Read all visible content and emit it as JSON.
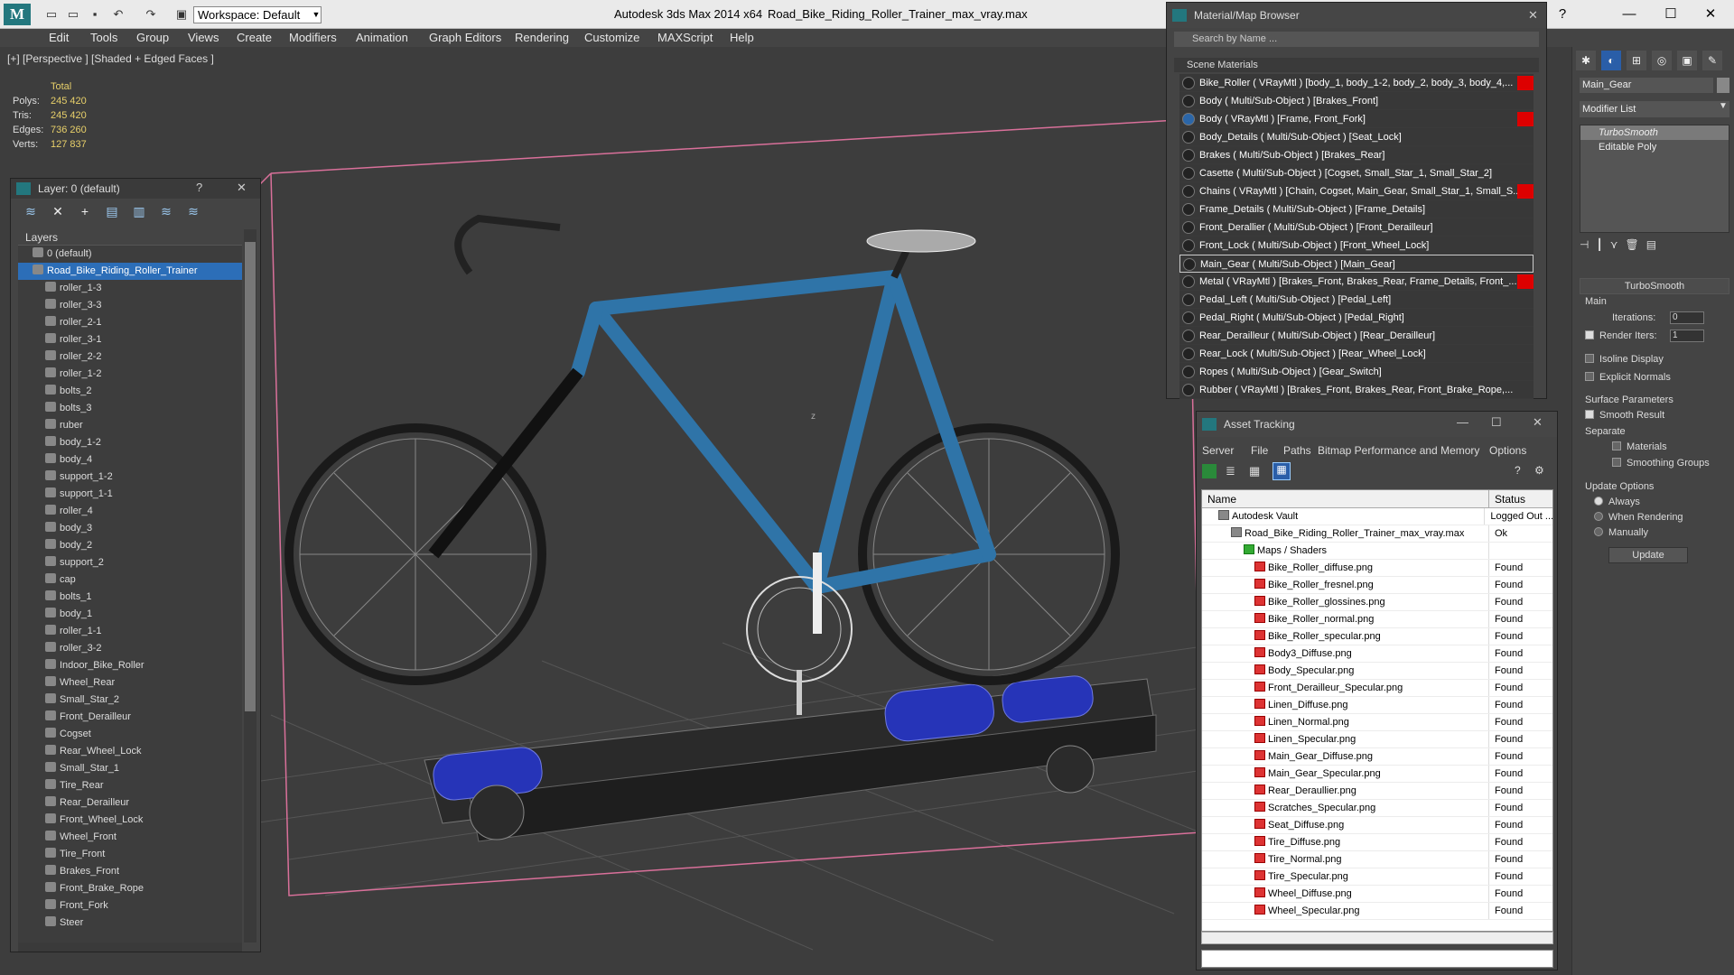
{
  "titlebar": {
    "workspace": "Workspace: Default",
    "app_title": "Autodesk 3ds Max  2014 x64",
    "file_title": "Road_Bike_Riding_Roller_Trainer_max_vray.max"
  },
  "menu": [
    "Edit",
    "Tools",
    "Group",
    "Views",
    "Create",
    "Modifiers",
    "Animation",
    "Graph Editors",
    "Rendering",
    "Customize",
    "MAXScript",
    "Help"
  ],
  "viewport": {
    "label": "[+] [Perspective ] [Shaded + Edged Faces ]",
    "stats_header": "Total",
    "stats": [
      {
        "k": "Polys:",
        "v": "245 420"
      },
      {
        "k": "Tris:",
        "v": "245 420"
      },
      {
        "k": "Edges:",
        "v": "736 260"
      },
      {
        "k": "Verts:",
        "v": "127 837"
      }
    ],
    "axis_z": "z"
  },
  "layer_panel": {
    "title": "Layer: 0 (default)",
    "help": "?",
    "close": "✕",
    "header": "Layers",
    "items": [
      {
        "label": "0 (default)",
        "level": 1
      },
      {
        "label": "Road_Bike_Riding_Roller_Trainer",
        "level": 1,
        "selected": true
      },
      {
        "label": "roller_1-3",
        "level": 2
      },
      {
        "label": "roller_3-3",
        "level": 2
      },
      {
        "label": "roller_2-1",
        "level": 2
      },
      {
        "label": "roller_3-1",
        "level": 2
      },
      {
        "label": "roller_2-2",
        "level": 2
      },
      {
        "label": "roller_1-2",
        "level": 2
      },
      {
        "label": "bolts_2",
        "level": 2
      },
      {
        "label": "bolts_3",
        "level": 2
      },
      {
        "label": "ruber",
        "level": 2
      },
      {
        "label": "body_1-2",
        "level": 2
      },
      {
        "label": "body_4",
        "level": 2
      },
      {
        "label": "support_1-2",
        "level": 2
      },
      {
        "label": "support_1-1",
        "level": 2
      },
      {
        "label": "roller_4",
        "level": 2
      },
      {
        "label": "body_3",
        "level": 2
      },
      {
        "label": "body_2",
        "level": 2
      },
      {
        "label": "support_2",
        "level": 2
      },
      {
        "label": "cap",
        "level": 2
      },
      {
        "label": "bolts_1",
        "level": 2
      },
      {
        "label": "body_1",
        "level": 2
      },
      {
        "label": "roller_1-1",
        "level": 2
      },
      {
        "label": "roller_3-2",
        "level": 2
      },
      {
        "label": "Indoor_Bike_Roller",
        "level": 2
      },
      {
        "label": "Wheel_Rear",
        "level": 2
      },
      {
        "label": "Small_Star_2",
        "level": 2
      },
      {
        "label": "Front_Derailleur",
        "level": 2
      },
      {
        "label": "Cogset",
        "level": 2
      },
      {
        "label": "Rear_Wheel_Lock",
        "level": 2
      },
      {
        "label": "Small_Star_1",
        "level": 2
      },
      {
        "label": "Tire_Rear",
        "level": 2
      },
      {
        "label": "Rear_Derailleur",
        "level": 2
      },
      {
        "label": "Front_Wheel_Lock",
        "level": 2
      },
      {
        "label": "Wheel_Front",
        "level": 2
      },
      {
        "label": "Tire_Front",
        "level": 2
      },
      {
        "label": "Brakes_Front",
        "level": 2
      },
      {
        "label": "Front_Brake_Rope",
        "level": 2
      },
      {
        "label": "Front_Fork",
        "level": 2
      },
      {
        "label": "Steer",
        "level": 2
      }
    ]
  },
  "material_browser": {
    "title": "Material/Map Browser",
    "close": "✕",
    "search_placeholder": "Search by Name ...",
    "section": "Scene Materials",
    "items": [
      {
        "label": "Bike_Roller  ( VRayMtl ) [body_1, body_1-2, body_2, body_3, body_4,...",
        "red": true
      },
      {
        "label": "Body  ( Multi/Sub-Object ) [Brakes_Front]"
      },
      {
        "label": "Body  ( VRayMtl ) [Frame, Front_Fork]",
        "red": true,
        "blue": true
      },
      {
        "label": "Body_Details  ( Multi/Sub-Object ) [Seat_Lock]"
      },
      {
        "label": "Brakes  ( Multi/Sub-Object ) [Brakes_Rear]"
      },
      {
        "label": "Casette  ( Multi/Sub-Object ) [Cogset, Small_Star_1, Small_Star_2]"
      },
      {
        "label": "Chains  ( VRayMtl ) [Chain, Cogset, Main_Gear, Small_Star_1, Small_S...",
        "red": true
      },
      {
        "label": "Frame_Details  ( Multi/Sub-Object ) [Frame_Details]"
      },
      {
        "label": "Front_Derallier  ( Multi/Sub-Object ) [Front_Derailleur]"
      },
      {
        "label": "Front_Lock  ( Multi/Sub-Object ) [Front_Wheel_Lock]"
      },
      {
        "label": "Main_Gear  ( Multi/Sub-Object ) [Main_Gear]",
        "selected": true
      },
      {
        "label": "Metal  ( VRayMtl ) [Brakes_Front, Brakes_Rear, Frame_Details, Front_...",
        "red": true
      },
      {
        "label": "Pedal_Left  ( Multi/Sub-Object ) [Pedal_Left]"
      },
      {
        "label": "Pedal_Right  ( Multi/Sub-Object ) [Pedal_Right]"
      },
      {
        "label": "Rear_Derailleur  ( Multi/Sub-Object ) [Rear_Derailleur]"
      },
      {
        "label": "Rear_Lock  ( Multi/Sub-Object ) [Rear_Wheel_Lock]"
      },
      {
        "label": "Ropes  ( Multi/Sub-Object ) [Gear_Switch]"
      },
      {
        "label": "Rubber  ( VRayMtl ) [Brakes_Front, Brakes_Rear, Front_Brake_Rope,..."
      }
    ]
  },
  "asset_tracking": {
    "title": "Asset Tracking",
    "menu": [
      "Server",
      "File",
      "Paths",
      "Bitmap Performance and Memory",
      "Options"
    ],
    "col_name": "Name",
    "col_status": "Status",
    "rows": [
      {
        "name": "Autodesk Vault",
        "status": "Logged Out ...",
        "indent": 18,
        "kind": "v"
      },
      {
        "name": "Road_Bike_Riding_Roller_Trainer_max_vray.max",
        "status": "Ok",
        "indent": 32,
        "kind": "v"
      },
      {
        "name": "Maps / Shaders",
        "status": "",
        "indent": 46,
        "kind": "f"
      },
      {
        "name": "Bike_Roller_diffuse.png",
        "status": "Found",
        "indent": 58
      },
      {
        "name": "Bike_Roller_fresnel.png",
        "status": "Found",
        "indent": 58
      },
      {
        "name": "Bike_Roller_glossines.png",
        "status": "Found",
        "indent": 58
      },
      {
        "name": "Bike_Roller_normal.png",
        "status": "Found",
        "indent": 58
      },
      {
        "name": "Bike_Roller_specular.png",
        "status": "Found",
        "indent": 58
      },
      {
        "name": "Body3_Diffuse.png",
        "status": "Found",
        "indent": 58
      },
      {
        "name": "Body_Specular.png",
        "status": "Found",
        "indent": 58
      },
      {
        "name": "Front_Derailleur_Specular.png",
        "status": "Found",
        "indent": 58
      },
      {
        "name": "Linen_Diffuse.png",
        "status": "Found",
        "indent": 58
      },
      {
        "name": "Linen_Normal.png",
        "status": "Found",
        "indent": 58
      },
      {
        "name": "Linen_Specular.png",
        "status": "Found",
        "indent": 58
      },
      {
        "name": "Main_Gear_Diffuse.png",
        "status": "Found",
        "indent": 58
      },
      {
        "name": "Main_Gear_Specular.png",
        "status": "Found",
        "indent": 58
      },
      {
        "name": "Rear_Deraullier.png",
        "status": "Found",
        "indent": 58
      },
      {
        "name": "Scratches_Specular.png",
        "status": "Found",
        "indent": 58
      },
      {
        "name": "Seat_Diffuse.png",
        "status": "Found",
        "indent": 58
      },
      {
        "name": "Tire_Diffuse.png",
        "status": "Found",
        "indent": 58
      },
      {
        "name": "Tire_Normal.png",
        "status": "Found",
        "indent": 58
      },
      {
        "name": "Tire_Specular.png",
        "status": "Found",
        "indent": 58
      },
      {
        "name": "Wheel_Diffuse.png",
        "status": "Found",
        "indent": 58
      },
      {
        "name": "Wheel_Specular.png",
        "status": "Found",
        "indent": 58
      }
    ]
  },
  "command_panel": {
    "object_name": "Main_Gear",
    "modifier_list": "Modifier List",
    "stack": [
      "TurboSmooth",
      "Editable Poly"
    ],
    "rollout_title": "TurboSmooth",
    "main_label": "Main",
    "iterations_label": "Iterations:",
    "iterations_value": "0",
    "render_iters_label": "Render Iters:",
    "render_iters_value": "1",
    "isoline": "Isoline Display",
    "explicit": "Explicit Normals",
    "surface_params": "Surface Parameters",
    "smooth_result": "Smooth Result",
    "separate": "Separate",
    "materials": "Materials",
    "smoothing_groups": "Smoothing Groups",
    "update_options": "Update Options",
    "always": "Always",
    "when_rendering": "When Rendering",
    "manually": "Manually",
    "update": "Update"
  }
}
